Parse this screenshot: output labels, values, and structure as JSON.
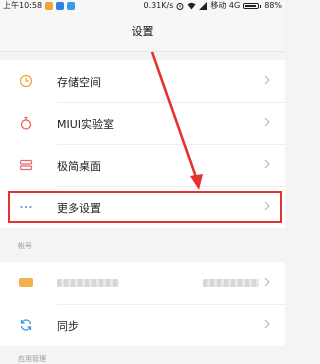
{
  "status_bar": {
    "time": "上午10:58",
    "speed": "0.31K/s",
    "carrier": "移动 4G",
    "battery": "88%",
    "battery_level": 0.88
  },
  "header": {
    "title": "设置"
  },
  "settings_items": [
    {
      "label": "存储空间",
      "icon": "clock-icon",
      "icon_color": "#f0a23a"
    },
    {
      "label": "MIUI实验室",
      "icon": "flask-icon",
      "icon_color": "#ee5a55"
    },
    {
      "label": "极简桌面",
      "icon": "layers-icon",
      "icon_color": "#e86a6a"
    },
    {
      "label": "更多设置",
      "icon": "more-dots-icon",
      "icon_color": "#3b8de0"
    }
  ],
  "account_section": {
    "label": "帐号",
    "account_item": {
      "icon": "account-card-icon",
      "icon_color": "#f2b24b"
    },
    "sync_item": {
      "label": "同步",
      "icon": "sync-icon",
      "icon_color": "#2f8fde"
    }
  },
  "app_section": {
    "label": "应用管理"
  },
  "annotation": {
    "highlight_color": "#e3322f"
  }
}
